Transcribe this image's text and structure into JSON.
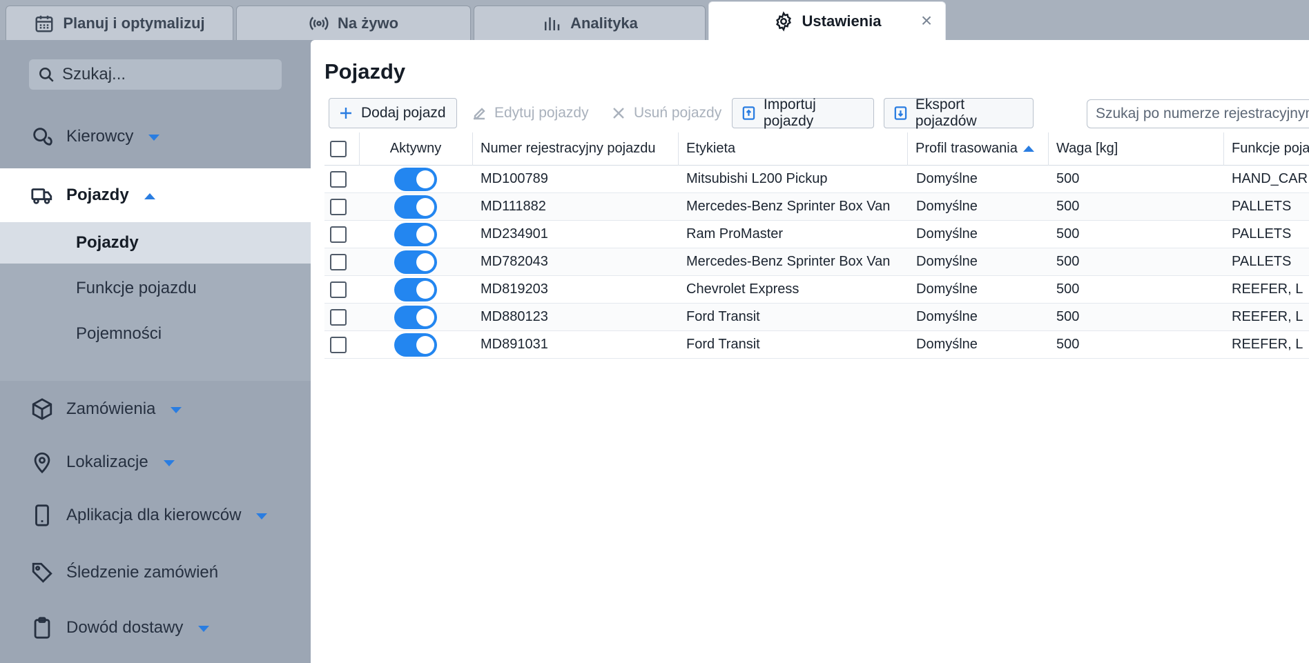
{
  "tabs": [
    {
      "label": "Planuj i optymalizuj",
      "icon": "calendar-icon"
    },
    {
      "label": "Na żywo",
      "icon": "broadcast-icon"
    },
    {
      "label": "Analityka",
      "icon": "bar-chart-icon"
    },
    {
      "label": "Ustawienia",
      "icon": "gear-icon",
      "active": true,
      "close": "×"
    }
  ],
  "sidebar": {
    "search_placeholder": "Szukaj...",
    "items": [
      {
        "label": "Kierowcy",
        "icon": "drivers-icon",
        "caret": "down"
      },
      {
        "label": "Pojazdy",
        "icon": "truck-icon",
        "caret": "up",
        "active": true
      },
      {
        "label": "Zamówienia",
        "icon": "package-icon",
        "caret": "down"
      },
      {
        "label": "Lokalizacje",
        "icon": "map-pin-icon",
        "caret": "down"
      },
      {
        "label": "Aplikacja dla kierowców",
        "icon": "mobile-icon",
        "caret": "down"
      },
      {
        "label": "Śledzenie zamówień",
        "icon": "tag-icon"
      },
      {
        "label": "Dowód dostawy",
        "icon": "clipboard-icon",
        "caret": "down"
      }
    ],
    "subitems": [
      {
        "label": "Pojazdy",
        "active": true
      },
      {
        "label": "Funkcje pojazdu"
      },
      {
        "label": "Pojemności"
      }
    ]
  },
  "main": {
    "title": "Pojazdy",
    "toolbar": {
      "add": "Dodaj pojazd",
      "edit": "Edytuj pojazdy",
      "delete": "Usuń pojazdy",
      "import": "Importuj pojazdy",
      "export": "Eksport pojazdów",
      "search_placeholder": "Szukaj po numerze rejestracyjnym"
    },
    "table": {
      "columns": [
        "Aktywny",
        "Numer rejestracyjny pojazdu",
        "Etykieta",
        "Profil trasowania",
        "Waga [kg]",
        "Funkcje poja"
      ],
      "sorted_column": "Profil trasowania",
      "rows": [
        {
          "active": true,
          "plate": "MD100789",
          "label": "Mitsubishi L200 Pickup",
          "profile": "Domyślne",
          "weight": "500",
          "features": "HAND_CAR"
        },
        {
          "active": true,
          "plate": "MD111882",
          "label": "Mercedes-Benz Sprinter Box Van",
          "profile": "Domyślne",
          "weight": "500",
          "features": "PALLETS"
        },
        {
          "active": true,
          "plate": "MD234901",
          "label": "Ram ProMaster",
          "profile": "Domyślne",
          "weight": "500",
          "features": "PALLETS"
        },
        {
          "active": true,
          "plate": "MD782043",
          "label": "Mercedes-Benz Sprinter Box Van",
          "profile": "Domyślne",
          "weight": "500",
          "features": "PALLETS"
        },
        {
          "active": true,
          "plate": "MD819203",
          "label": "Chevrolet Express",
          "profile": "Domyślne",
          "weight": "500",
          "features": "REEFER, L"
        },
        {
          "active": true,
          "plate": "MD880123",
          "label": "Ford Transit",
          "profile": "Domyślne",
          "weight": "500",
          "features": "REEFER, L"
        },
        {
          "active": true,
          "plate": "MD891031",
          "label": "Ford Transit",
          "profile": "Domyślne",
          "weight": "500",
          "features": "REEFER, L"
        }
      ]
    }
  },
  "colors": {
    "accent": "#2386f0",
    "sidebar_bg": "#9ca6b4",
    "active_bg": "#ffffff"
  }
}
